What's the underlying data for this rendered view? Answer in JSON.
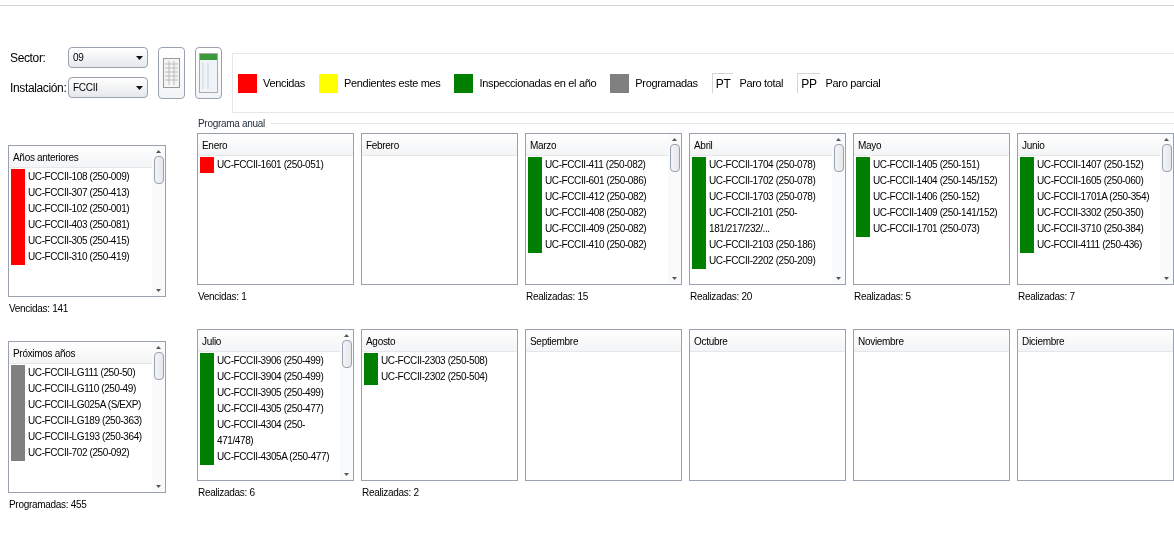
{
  "filters": [
    {
      "label": "Sector:",
      "value": "09"
    },
    {
      "label": "Instalación:",
      "value": "FCCII"
    }
  ],
  "legend": [
    {
      "kind": "swatch",
      "color": "#ff0000",
      "label": "Vencidas"
    },
    {
      "kind": "swatch",
      "color": "#ffff00",
      "label": "Pendientes este mes"
    },
    {
      "kind": "swatch",
      "color": "#008000",
      "label": "Inspeccionadas en el año"
    },
    {
      "kind": "swatch",
      "color": "#808080",
      "label": "Programadas"
    },
    {
      "kind": "code",
      "code": "PT",
      "label": "Paro total"
    },
    {
      "kind": "code",
      "code": "PP",
      "label": "Paro parcial"
    }
  ],
  "group_title": "Programa anual",
  "rows": [
    {
      "side": {
        "title": "Años anteriores",
        "scrollable": true,
        "footer": "Vencidas: 141",
        "items": [
          {
            "label": "UC-FCCII-108 (250-009)",
            "color": "#ff0000"
          },
          {
            "label": "UC-FCCII-307 (250-413)",
            "color": "#ff0000"
          },
          {
            "label": "UC-FCCII-102 (250-001)",
            "color": "#ff0000"
          },
          {
            "label": "UC-FCCII-403 (250-081)",
            "color": "#ff0000"
          },
          {
            "label": "UC-FCCII-305 (250-415)",
            "color": "#ff0000"
          },
          {
            "label": "UC-FCCII-310 (250-419)",
            "color": "#ff0000"
          }
        ]
      },
      "months": [
        {
          "title": "Enero",
          "scrollable": false,
          "footer": "Vencidas: 1",
          "items": [
            {
              "label": "UC-FCCII-1601 (250-051)",
              "color": "#ff0000"
            }
          ]
        },
        {
          "title": "Febrero",
          "scrollable": false
        },
        {
          "title": "Marzo",
          "scrollable": true,
          "footer": "Realizadas: 15",
          "items": [
            {
              "label": "UC-FCCII-411 (250-082)",
              "color": "#008000"
            },
            {
              "label": "UC-FCCII-601 (250-086)",
              "color": "#008000"
            },
            {
              "label": "UC-FCCII-412 (250-082)",
              "color": "#008000"
            },
            {
              "label": "UC-FCCII-408 (250-082)",
              "color": "#008000"
            },
            {
              "label": "UC-FCCII-409 (250-082)",
              "color": "#008000"
            },
            {
              "label": "UC-FCCII-410 (250-082)",
              "color": "#008000"
            }
          ]
        },
        {
          "title": "Abril",
          "scrollable": true,
          "footer": "Realizadas: 20",
          "items": [
            {
              "label": "UC-FCCII-1704 (250-078)",
              "color": "#008000"
            },
            {
              "label": "UC-FCCII-1702 (250-078)",
              "color": "#008000"
            },
            {
              "label": "UC-FCCII-1703 (250-078)",
              "color": "#008000"
            },
            {
              "label": "UC-FCCII-2101 (250-181/217/232/...",
              "color": "#008000"
            },
            {
              "label": "UC-FCCII-2103 (250-186)",
              "color": "#008000"
            },
            {
              "label": "UC-FCCII-2202 (250-209)",
              "color": "#008000"
            }
          ]
        },
        {
          "title": "Mayo",
          "scrollable": false,
          "footer": "Realizadas: 5",
          "items": [
            {
              "label": "UC-FCCII-1405 (250-151)",
              "color": "#008000"
            },
            {
              "label": "UC-FCCII-1404 (250-145/152)",
              "color": "#008000"
            },
            {
              "label": "UC-FCCII-1406 (250-152)",
              "color": "#008000"
            },
            {
              "label": "UC-FCCII-1409 (250-141/152)",
              "color": "#008000"
            },
            {
              "label": "UC-FCCII-1701 (250-073)",
              "color": "#008000"
            }
          ]
        },
        {
          "title": "Junio",
          "scrollable": true,
          "footer": "Realizadas: 7",
          "items": [
            {
              "label": "UC-FCCII-1407 (250-152)",
              "color": "#008000"
            },
            {
              "label": "UC-FCCII-1605 (250-060)",
              "color": "#008000"
            },
            {
              "label": "UC-FCCII-1701A (250-354)",
              "color": "#008000"
            },
            {
              "label": "UC-FCCII-3302 (250-350)",
              "color": "#008000"
            },
            {
              "label": "UC-FCCII-3710 (250-384)",
              "color": "#008000"
            },
            {
              "label": "UC-FCCII-4111 (250-436)",
              "color": "#008000"
            }
          ]
        }
      ]
    },
    {
      "side": {
        "title": "Próximos años",
        "scrollable": true,
        "footer": "Programadas: 455",
        "items": [
          {
            "label": "UC-FCCII-LG111 (250-50)",
            "color": "#808080"
          },
          {
            "label": "UC-FCCII-LG110 (250-49)",
            "color": "#808080"
          },
          {
            "label": "UC-FCCII-LG025A (S/EXP)",
            "color": "#808080"
          },
          {
            "label": "UC-FCCII-LG189 (250-363)",
            "color": "#808080"
          },
          {
            "label": "UC-FCCII-LG193 (250-364)",
            "color": "#808080"
          },
          {
            "label": "UC-FCCII-702 (250-092)",
            "color": "#808080"
          }
        ]
      },
      "months": [
        {
          "title": "Julio",
          "scrollable": true,
          "footer": "Realizadas: 6",
          "items": [
            {
              "label": "UC-FCCII-3906 (250-499)",
              "color": "#008000"
            },
            {
              "label": "UC-FCCII-3904 (250-499)",
              "color": "#008000"
            },
            {
              "label": "UC-FCCII-3905 (250-499)",
              "color": "#008000"
            },
            {
              "label": "UC-FCCII-4305 (250-477)",
              "color": "#008000"
            },
            {
              "label": "UC-FCCII-4304 (250-471/478)",
              "color": "#008000"
            },
            {
              "label": "UC-FCCII-4305A (250-477)",
              "color": "#008000"
            }
          ]
        },
        {
          "title": "Agosto",
          "scrollable": false,
          "footer": "Realizadas: 2",
          "items": [
            {
              "label": "UC-FCCII-2303 (250-508)",
              "color": "#008000"
            },
            {
              "label": "UC-FCCII-2302 (250-504)",
              "color": "#008000"
            }
          ]
        },
        {
          "title": "Septiembre",
          "scrollable": false
        },
        {
          "title": "Octubre",
          "scrollable": false
        },
        {
          "title": "Noviembre",
          "scrollable": false
        },
        {
          "title": "Diciembre",
          "scrollable": false
        }
      ]
    }
  ]
}
